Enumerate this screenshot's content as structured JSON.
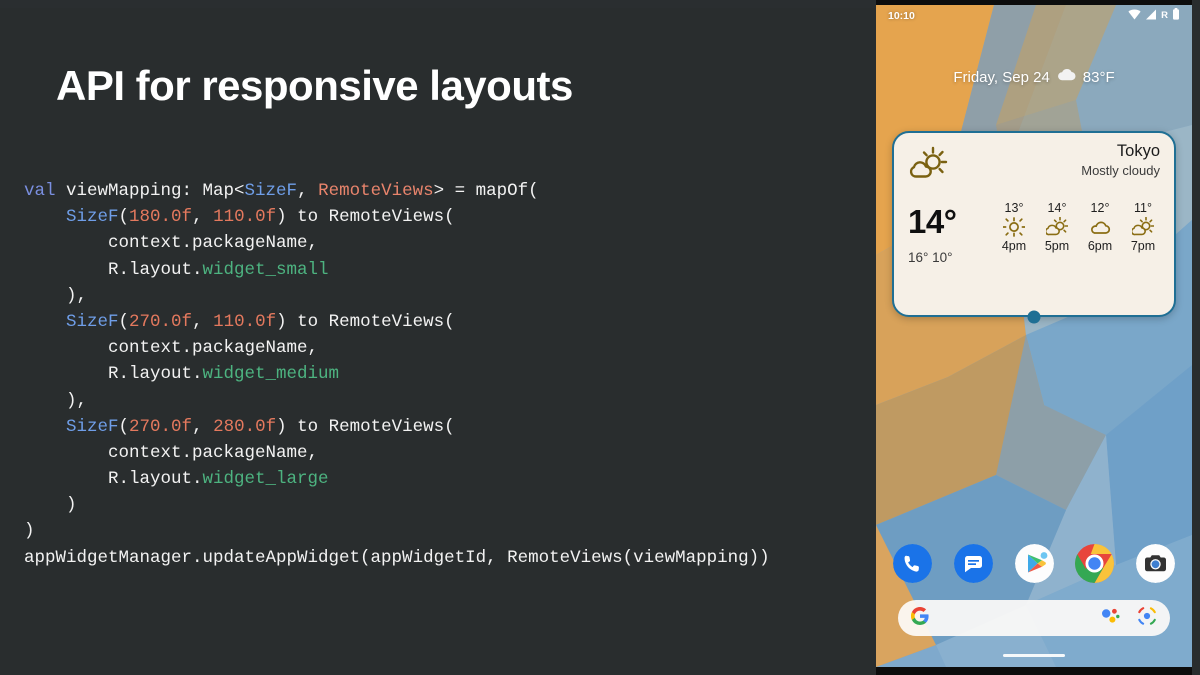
{
  "slide": {
    "title": "API for responsive layouts",
    "background_color": "#292d2e",
    "title_color": "#ffffff"
  },
  "code": {
    "language": "kotlin",
    "colors": {
      "keyword": "#7a8fe0",
      "type": "#6f9ee8",
      "number": "#e4795e",
      "class": "#e8846c",
      "resource": "#4db380",
      "plain": "#f2f2f2"
    },
    "lines": [
      {
        "id": 0,
        "tokens": [
          {
            "t": "val",
            "c": "kw"
          },
          {
            "t": " viewMapping: Map<",
            "c": "pl"
          },
          {
            "t": "SizeF",
            "c": "typ"
          },
          {
            "t": ", ",
            "c": "pl"
          },
          {
            "t": "RemoteViews",
            "c": "cls"
          },
          {
            "t": "> = mapOf(",
            "c": "pl"
          }
        ]
      },
      {
        "id": 1,
        "tokens": [
          {
            "t": "    ",
            "c": "pl"
          },
          {
            "t": "SizeF",
            "c": "typ"
          },
          {
            "t": "(",
            "c": "pl"
          },
          {
            "t": "180.0f",
            "c": "num"
          },
          {
            "t": ", ",
            "c": "pl"
          },
          {
            "t": "110.0f",
            "c": "num"
          },
          {
            "t": ") to RemoteViews(",
            "c": "pl"
          }
        ]
      },
      {
        "id": 2,
        "tokens": [
          {
            "t": "        context.packageName,",
            "c": "pl"
          }
        ]
      },
      {
        "id": 3,
        "tokens": [
          {
            "t": "        R.layout.",
            "c": "pl"
          },
          {
            "t": "widget_small",
            "c": "res"
          }
        ]
      },
      {
        "id": 4,
        "tokens": [
          {
            "t": "    ),",
            "c": "pl"
          }
        ]
      },
      {
        "id": 5,
        "tokens": [
          {
            "t": "    ",
            "c": "pl"
          },
          {
            "t": "SizeF",
            "c": "typ"
          },
          {
            "t": "(",
            "c": "pl"
          },
          {
            "t": "270.0f",
            "c": "num"
          },
          {
            "t": ", ",
            "c": "pl"
          },
          {
            "t": "110.0f",
            "c": "num"
          },
          {
            "t": ") to RemoteViews(",
            "c": "pl"
          }
        ]
      },
      {
        "id": 6,
        "tokens": [
          {
            "t": "        context.packageName,",
            "c": "pl"
          }
        ]
      },
      {
        "id": 7,
        "tokens": [
          {
            "t": "        R.layout.",
            "c": "pl"
          },
          {
            "t": "widget_medium",
            "c": "res"
          }
        ]
      },
      {
        "id": 8,
        "tokens": [
          {
            "t": "    ),",
            "c": "pl"
          }
        ]
      },
      {
        "id": 9,
        "tokens": [
          {
            "t": "    ",
            "c": "pl"
          },
          {
            "t": "SizeF",
            "c": "typ"
          },
          {
            "t": "(",
            "c": "pl"
          },
          {
            "t": "270.0f",
            "c": "num"
          },
          {
            "t": ", ",
            "c": "pl"
          },
          {
            "t": "280.0f",
            "c": "num"
          },
          {
            "t": ") to RemoteViews(",
            "c": "pl"
          }
        ]
      },
      {
        "id": 10,
        "tokens": [
          {
            "t": "        context.packageName,",
            "c": "pl"
          }
        ]
      },
      {
        "id": 11,
        "tokens": [
          {
            "t": "        R.layout.",
            "c": "pl"
          },
          {
            "t": "widget_large",
            "c": "res"
          }
        ]
      },
      {
        "id": 12,
        "tokens": [
          {
            "t": "    )",
            "c": "pl"
          }
        ]
      },
      {
        "id": 13,
        "tokens": [
          {
            "t": ")",
            "c": "pl"
          }
        ]
      },
      {
        "id": 14,
        "tokens": [
          {
            "t": "appWidgetManager.updateAppWidget(appWidgetId, RemoteViews(viewMapping))",
            "c": "pl"
          }
        ]
      }
    ]
  },
  "phone": {
    "status_bar": {
      "time": "10:10",
      "icons": [
        "wifi-icon",
        "signal-icon",
        "roaming-icon",
        "battery-icon"
      ],
      "roaming_label": "R"
    },
    "date_row": {
      "date": "Friday, Sep 24",
      "condition_icon": "cloud-icon",
      "temperature": "83°F"
    },
    "widget": {
      "city": "Tokyo",
      "condition": "Mostly cloudy",
      "condition_icon": "sun-behind-cloud-icon",
      "current_temp": "14°",
      "high_low": "16°  10°",
      "border_color": "#1f6f94",
      "background_color": "#f6f0e7",
      "hourly": [
        {
          "temp": "13°",
          "icon": "sun-icon",
          "time": "4pm"
        },
        {
          "temp": "14°",
          "icon": "sun-behind-cloud-icon",
          "time": "5pm"
        },
        {
          "temp": "12°",
          "icon": "cloud-icon",
          "time": "6pm"
        },
        {
          "temp": "11°",
          "icon": "sun-behind-cloud-icon",
          "time": "7pm"
        }
      ]
    },
    "dock": [
      {
        "name": "phone-app",
        "icon": "phone-icon"
      },
      {
        "name": "messages-app",
        "icon": "messages-icon"
      },
      {
        "name": "play-store-app",
        "icon": "play-store-icon"
      },
      {
        "name": "chrome-app",
        "icon": "chrome-icon"
      },
      {
        "name": "camera-app",
        "icon": "camera-icon"
      }
    ],
    "search_bar": {
      "logo_icon": "google-g-icon",
      "assistant_icon": "google-assistant-icon",
      "lens_icon": "google-lens-icon"
    }
  }
}
